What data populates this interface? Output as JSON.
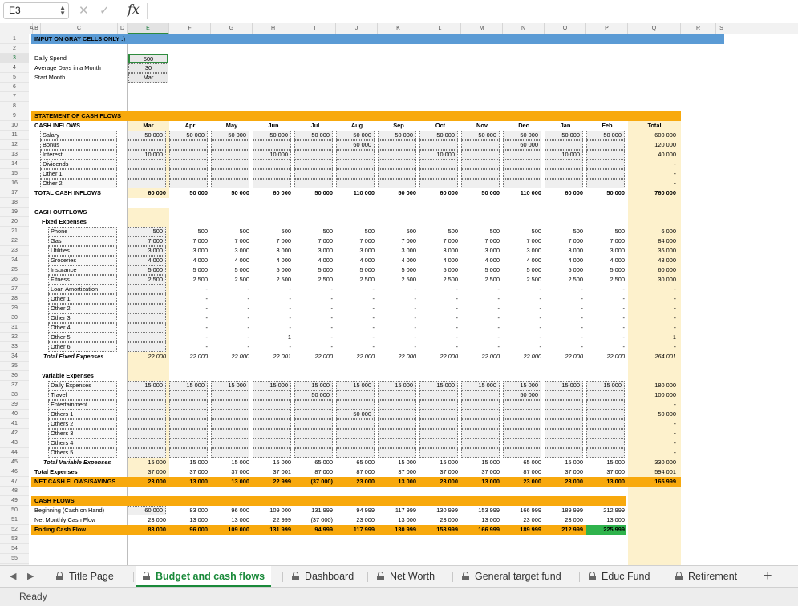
{
  "formula_bar": {
    "cell_ref": "E3",
    "cancel_icon": "✕",
    "enter_icon": "✓",
    "fx_label": "fx",
    "value": ""
  },
  "columns": [
    "A",
    "B",
    "C",
    "D",
    "E",
    "F",
    "G",
    "H",
    "I",
    "J",
    "K",
    "L",
    "M",
    "N",
    "O",
    "P",
    "Q",
    "R",
    "S"
  ],
  "selected_column": "E",
  "selected_row": "3",
  "months": [
    "Mar",
    "Apr",
    "May",
    "Jun",
    "Jul",
    "Aug",
    "Sep",
    "Oct",
    "Nov",
    "Dec",
    "Jan",
    "Feb"
  ],
  "total_label": "Total",
  "colors": {
    "accent_blue": "#5b9bd5",
    "accent_orange": "#f8a90d",
    "light_yellow": "#fdf1cc",
    "tab_active_green": "#1a8a3a",
    "highlight_green": "#2fb34c"
  },
  "header": {
    "title": "INPUT ON GRAY CELLS ONLY :)"
  },
  "inputs": [
    {
      "label": "Daily Spend",
      "value": "500"
    },
    {
      "label": "Average Days in a Month",
      "value": "30"
    },
    {
      "label": "Start Month",
      "value": "Mar"
    }
  ],
  "statement_title": "STATEMENT OF CASH FLOWS",
  "inflows": {
    "title": "CASH INFLOWS",
    "rows": [
      {
        "label": "Salary",
        "values": [
          "50 000",
          "50 000",
          "50 000",
          "50 000",
          "50 000",
          "50 000",
          "50 000",
          "50 000",
          "50 000",
          "50 000",
          "50 000",
          "50 000"
        ],
        "total": "600 000"
      },
      {
        "label": "Bonus",
        "values": [
          "",
          "",
          "",
          "",
          "",
          "60 000",
          "",
          "",
          "",
          "60 000",
          "",
          ""
        ],
        "total": "120 000"
      },
      {
        "label": "Interest",
        "values": [
          "10 000",
          "",
          "",
          "10 000",
          "",
          "",
          "",
          "10 000",
          "",
          "",
          "10 000",
          ""
        ],
        "total": "40 000"
      },
      {
        "label": "Dividends",
        "values": [
          "",
          "",
          "",
          "",
          "",
          "",
          "",
          "",
          "",
          "",
          "",
          ""
        ],
        "total": "-"
      },
      {
        "label": "Other 1",
        "values": [
          "",
          "",
          "",
          "",
          "",
          "",
          "",
          "",
          "",
          "",
          "",
          ""
        ],
        "total": "-"
      },
      {
        "label": "Other 2",
        "values": [
          "",
          "",
          "",
          "",
          "",
          "",
          "",
          "",
          "",
          "",
          "",
          ""
        ],
        "total": "-"
      }
    ],
    "total": {
      "label": "TOTAL CASH INFLOWS",
      "values": [
        "60 000",
        "50 000",
        "50 000",
        "60 000",
        "50 000",
        "110 000",
        "50 000",
        "60 000",
        "50 000",
        "110 000",
        "60 000",
        "50 000"
      ],
      "total": "760 000"
    }
  },
  "outflows": {
    "title": "CASH OUTFLOWS",
    "fixed_title": "Fixed Expenses",
    "fixed": [
      {
        "label": "Phone",
        "values": [
          "500",
          "500",
          "500",
          "500",
          "500",
          "500",
          "500",
          "500",
          "500",
          "500",
          "500",
          "500"
        ],
        "total": "6 000"
      },
      {
        "label": "Gas",
        "values": [
          "7 000",
          "7 000",
          "7 000",
          "7 000",
          "7 000",
          "7 000",
          "7 000",
          "7 000",
          "7 000",
          "7 000",
          "7 000",
          "7 000"
        ],
        "total": "84 000"
      },
      {
        "label": "Utilities",
        "values": [
          "3 000",
          "3 000",
          "3 000",
          "3 000",
          "3 000",
          "3 000",
          "3 000",
          "3 000",
          "3 000",
          "3 000",
          "3 000",
          "3 000"
        ],
        "total": "36 000"
      },
      {
        "label": "Groceries",
        "values": [
          "4 000",
          "4 000",
          "4 000",
          "4 000",
          "4 000",
          "4 000",
          "4 000",
          "4 000",
          "4 000",
          "4 000",
          "4 000",
          "4 000"
        ],
        "total": "48 000"
      },
      {
        "label": "Insurance",
        "values": [
          "5 000",
          "5 000",
          "5 000",
          "5 000",
          "5 000",
          "5 000",
          "5 000",
          "5 000",
          "5 000",
          "5 000",
          "5 000",
          "5 000"
        ],
        "total": "60 000"
      },
      {
        "label": "Fitness",
        "values": [
          "2 500",
          "2 500",
          "2 500",
          "2 500",
          "2 500",
          "2 500",
          "2 500",
          "2 500",
          "2 500",
          "2 500",
          "2 500",
          "2 500"
        ],
        "total": "30 000"
      },
      {
        "label": "Loan Amortization",
        "values": [
          "",
          "-",
          "-",
          "-",
          "-",
          "-",
          "-",
          "-",
          "-",
          "-",
          "-",
          "-"
        ],
        "total": "-"
      },
      {
        "label": "Other 1",
        "values": [
          "",
          "-",
          "-",
          "-",
          "-",
          "-",
          "-",
          "-",
          "-",
          "-",
          "-",
          "-"
        ],
        "total": "-"
      },
      {
        "label": "Other 2",
        "values": [
          "",
          "-",
          "-",
          "-",
          "-",
          "-",
          "-",
          "-",
          "-",
          "-",
          "-",
          "-"
        ],
        "total": "-"
      },
      {
        "label": "Other 3",
        "values": [
          "",
          "-",
          "-",
          "-",
          "-",
          "-",
          "-",
          "-",
          "-",
          "-",
          "-",
          "-"
        ],
        "total": "-"
      },
      {
        "label": "Other 4",
        "values": [
          "",
          "-",
          "-",
          "-",
          "-",
          "-",
          "-",
          "-",
          "-",
          "-",
          "-",
          "-"
        ],
        "total": "-"
      },
      {
        "label": "Other 5",
        "values": [
          "",
          "-",
          "-",
          "1",
          "-",
          "-",
          "-",
          "-",
          "-",
          "-",
          "-",
          "-"
        ],
        "total": "1"
      },
      {
        "label": "Other 6",
        "values": [
          "",
          "-",
          "-",
          "-",
          "-",
          "-",
          "-",
          "-",
          "-",
          "-",
          "-",
          "-"
        ],
        "total": "-"
      }
    ],
    "fixed_total": {
      "label": "Total Fixed Expenses",
      "values": [
        "22 000",
        "22 000",
        "22 000",
        "22 001",
        "22 000",
        "22 000",
        "22 000",
        "22 000",
        "22 000",
        "22 000",
        "22 000",
        "22 000"
      ],
      "total": "264 001"
    },
    "variable_title": "Variable Expenses",
    "variable": [
      {
        "label": "Daily Expenses",
        "values": [
          "15 000",
          "15 000",
          "15 000",
          "15 000",
          "15 000",
          "15 000",
          "15 000",
          "15 000",
          "15 000",
          "15 000",
          "15 000",
          "15 000"
        ],
        "total": "180 000"
      },
      {
        "label": "Travel",
        "values": [
          "",
          "",
          "",
          "",
          "50 000",
          "",
          "",
          "",
          "",
          "50 000",
          "",
          ""
        ],
        "total": "100 000"
      },
      {
        "label": "Entertainment",
        "values": [
          "",
          "",
          "",
          "",
          "",
          "",
          "",
          "",
          "",
          "",
          "",
          ""
        ],
        "total": "-"
      },
      {
        "label": "Others 1",
        "values": [
          "",
          "",
          "",
          "",
          "",
          "50 000",
          "",
          "",
          "",
          "",
          "",
          ""
        ],
        "total": "50 000"
      },
      {
        "label": "Others 2",
        "values": [
          "",
          "",
          "",
          "",
          "",
          "",
          "",
          "",
          "",
          "",
          "",
          ""
        ],
        "total": "-"
      },
      {
        "label": "Others 3",
        "values": [
          "",
          "",
          "",
          "",
          "",
          "",
          "",
          "",
          "",
          "",
          "",
          ""
        ],
        "total": "-"
      },
      {
        "label": "Others 4",
        "values": [
          "",
          "",
          "",
          "",
          "",
          "",
          "",
          "",
          "",
          "",
          "",
          ""
        ],
        "total": "-"
      },
      {
        "label": "Others 5",
        "values": [
          "",
          "",
          "",
          "",
          "",
          "",
          "",
          "",
          "",
          "",
          "",
          ""
        ],
        "total": "-"
      }
    ],
    "variable_total": {
      "label": "Total Variable Expenses",
      "values": [
        "15 000",
        "15 000",
        "15 000",
        "15 000",
        "65 000",
        "65 000",
        "15 000",
        "15 000",
        "15 000",
        "65 000",
        "15 000",
        "15 000"
      ],
      "total": "330 000"
    },
    "total_expenses": {
      "label": "Total Expenses",
      "values": [
        "37 000",
        "37 000",
        "37 000",
        "37 001",
        "87 000",
        "87 000",
        "37 000",
        "37 000",
        "37 000",
        "87 000",
        "37 000",
        "37 000"
      ],
      "total": "594 001"
    },
    "net": {
      "label": "NET CASH FLOWS/SAVINGS",
      "values": [
        "23 000",
        "13 000",
        "13 000",
        "22 999",
        "(37 000)",
        "23 000",
        "13 000",
        "23 000",
        "13 000",
        "23 000",
        "23 000",
        "13 000"
      ],
      "total": "165 999"
    }
  },
  "cash_flows": {
    "title": "CASH FLOWS",
    "rows": [
      {
        "label": "Beginning (Cash on Hand)",
        "values": [
          "60 000",
          "83 000",
          "96 000",
          "109 000",
          "131 999",
          "94 999",
          "117 999",
          "130 999",
          "153 999",
          "166 999",
          "189 999",
          "212 999"
        ]
      },
      {
        "label": "Net Monthly Cash Flow",
        "values": [
          "23 000",
          "13 000",
          "13 000",
          "22 999",
          "(37 000)",
          "23 000",
          "13 000",
          "23 000",
          "13 000",
          "23 000",
          "23 000",
          "13 000"
        ]
      }
    ],
    "ending": {
      "label": "Ending Cash Flow",
      "values": [
        "83 000",
        "96 000",
        "109 000",
        "131 999",
        "94 999",
        "117 999",
        "130 999",
        "153 999",
        "166 999",
        "189 999",
        "212 999",
        "225 999"
      ]
    }
  },
  "sheet_tabs": [
    {
      "label": "Title Page",
      "active": false
    },
    {
      "label": "Budget and cash flows",
      "active": true
    },
    {
      "label": "Dashboard",
      "active": false
    },
    {
      "label": "Net Worth",
      "active": false
    },
    {
      "label": "General target fund",
      "active": false
    },
    {
      "label": "Educ Fund",
      "active": false
    },
    {
      "label": "Retirement",
      "active": false
    }
  ],
  "add_sheet_icon": "+",
  "nav_prev_icon": "◀",
  "nav_next_icon": "▶",
  "status": "Ready"
}
